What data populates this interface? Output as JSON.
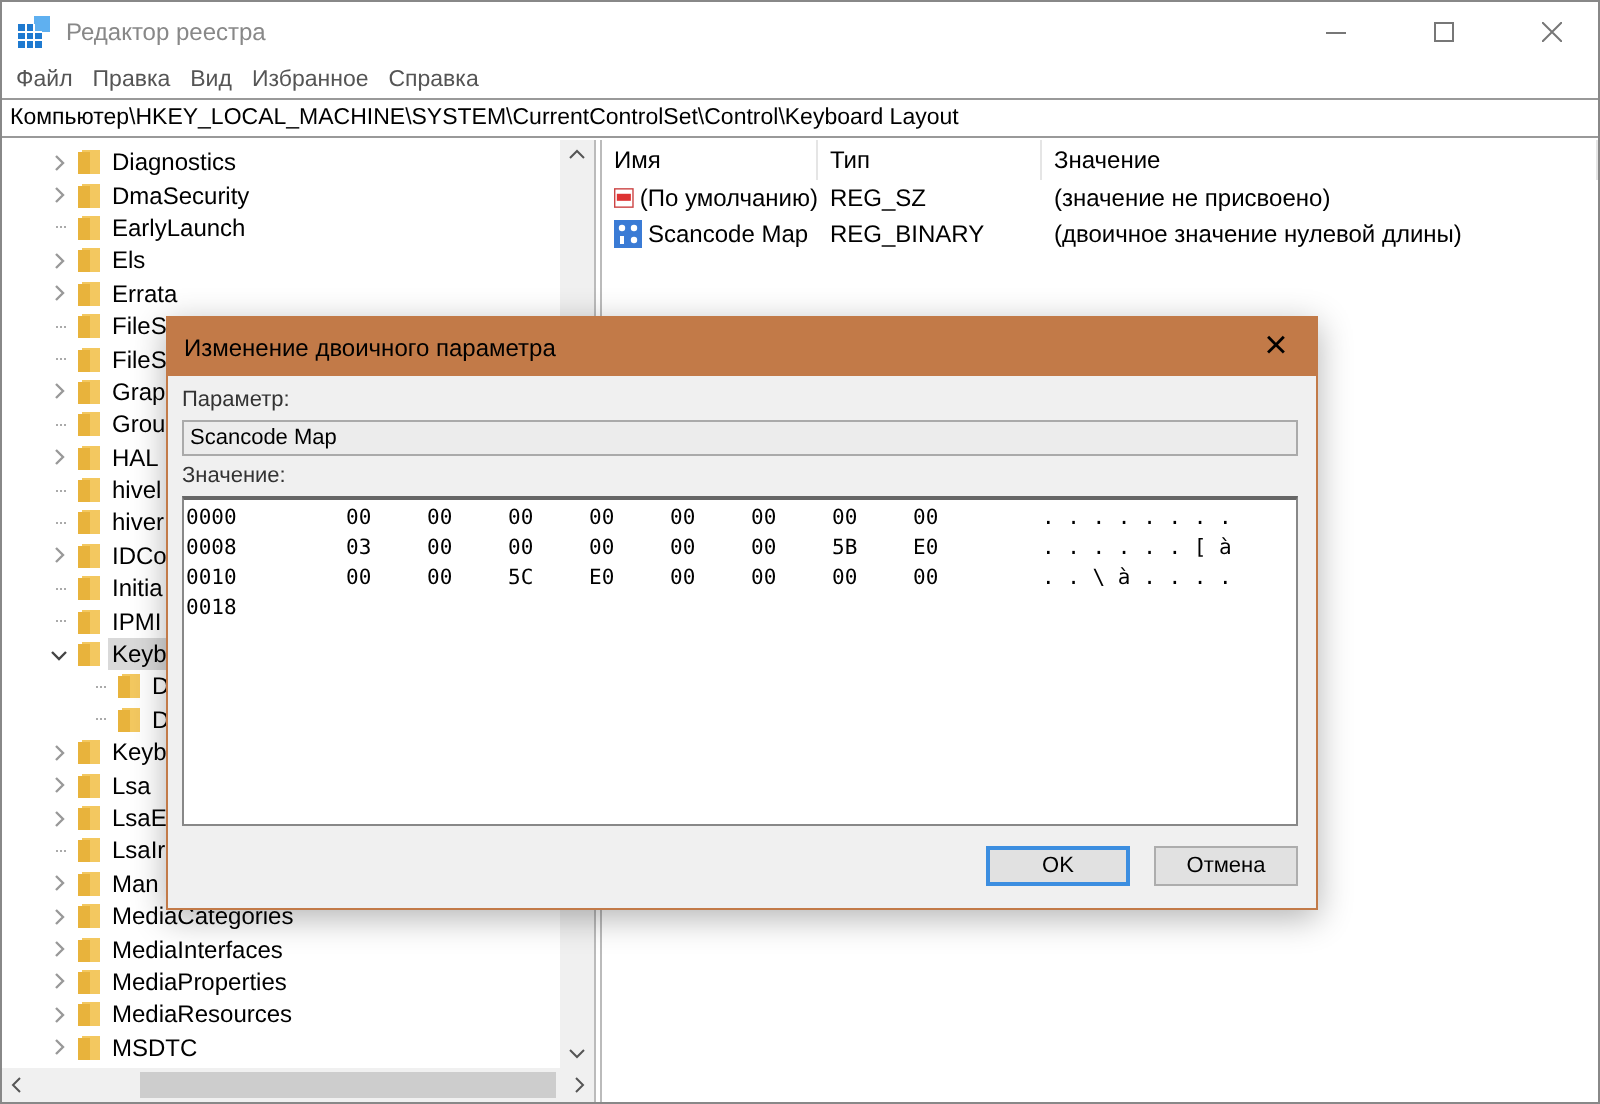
{
  "window": {
    "title": "Редактор реестра"
  },
  "menu": [
    "Файл",
    "Правка",
    "Вид",
    "Избранное",
    "Справка"
  ],
  "address": "Компьютер\\HKEY_LOCAL_MACHINE\\SYSTEM\\CurrentControlSet\\Control\\Keyboard Layout",
  "tree": [
    {
      "label": "Diagnostics",
      "has_children": true,
      "selected": false
    },
    {
      "label": "DmaSecurity",
      "has_children": true,
      "selected": false
    },
    {
      "label": "EarlyLaunch",
      "has_children": false,
      "selected": false
    },
    {
      "label": "Els",
      "has_children": true,
      "selected": false
    },
    {
      "label": "Errata",
      "has_children": true,
      "selected": false
    },
    {
      "label": "FileS",
      "has_children": false,
      "selected": false
    },
    {
      "label": "FileS",
      "has_children": false,
      "selected": false
    },
    {
      "label": "Grap",
      "has_children": true,
      "selected": false
    },
    {
      "label": "Grou",
      "has_children": false,
      "selected": false
    },
    {
      "label": "HAL",
      "has_children": true,
      "selected": false
    },
    {
      "label": "hivel",
      "has_children": false,
      "selected": false
    },
    {
      "label": "hiver",
      "has_children": false,
      "selected": false
    },
    {
      "label": "IDCo",
      "has_children": true,
      "selected": false
    },
    {
      "label": "Initia",
      "has_children": false,
      "selected": false
    },
    {
      "label": "IPMI",
      "has_children": false,
      "selected": false
    },
    {
      "label": "Keyb",
      "selected": true,
      "expanded": true,
      "children": [
        {
          "label": "D",
          "has_children": false,
          "selected": false
        },
        {
          "label": "D",
          "has_children": false,
          "selected": false
        }
      ]
    },
    {
      "label": "Keyb",
      "has_children": true,
      "selected": false
    },
    {
      "label": "Lsa",
      "has_children": true,
      "selected": false
    },
    {
      "label": "LsaE",
      "has_children": true,
      "selected": false
    },
    {
      "label": "LsaIr",
      "has_children": false,
      "selected": false
    },
    {
      "label": "Man",
      "has_children": true,
      "selected": false
    },
    {
      "label": "MediaCategories",
      "has_children": true,
      "selected": false
    },
    {
      "label": "MediaInterfaces",
      "has_children": true,
      "selected": false
    },
    {
      "label": "MediaProperties",
      "has_children": true,
      "selected": false
    },
    {
      "label": "MediaResources",
      "has_children": true,
      "selected": false
    },
    {
      "label": "MSDTC",
      "has_children": true,
      "selected": false
    }
  ],
  "values": {
    "columns": [
      "Имя",
      "Тип",
      "Значение"
    ],
    "rows": [
      {
        "kind": "string",
        "name": "(По умолчанию)",
        "type": "REG_SZ",
        "data": "(значение не присвоено)"
      },
      {
        "kind": "binary",
        "name": "Scancode Map",
        "type": "REG_BINARY",
        "data": "(двоичное значение нулевой длины)"
      }
    ]
  },
  "dialog": {
    "title": "Изменение двоичного параметра",
    "close": "×",
    "param_label": "Параметр:",
    "param_value": "Scancode Map",
    "value_label": "Значение:",
    "hex_rows": [
      {
        "address": "0000",
        "bytes": [
          "00",
          "00",
          "00",
          "00",
          "00",
          "00",
          "00",
          "00"
        ],
        "ascii": ". . . . . . . ."
      },
      {
        "address": "0008",
        "bytes": [
          "03",
          "00",
          "00",
          "00",
          "00",
          "00",
          "5B",
          "E0"
        ],
        "ascii": ". . . . . . [ à"
      },
      {
        "address": "0010",
        "bytes": [
          "00",
          "00",
          "5C",
          "E0",
          "00",
          "00",
          "00",
          "00"
        ],
        "ascii": ". . \\ à . . . ."
      },
      {
        "address": "0018"
      }
    ],
    "buttons": [
      {
        "label": "OK",
        "default": true
      },
      {
        "label": "Отмена",
        "default": false
      }
    ]
  }
}
